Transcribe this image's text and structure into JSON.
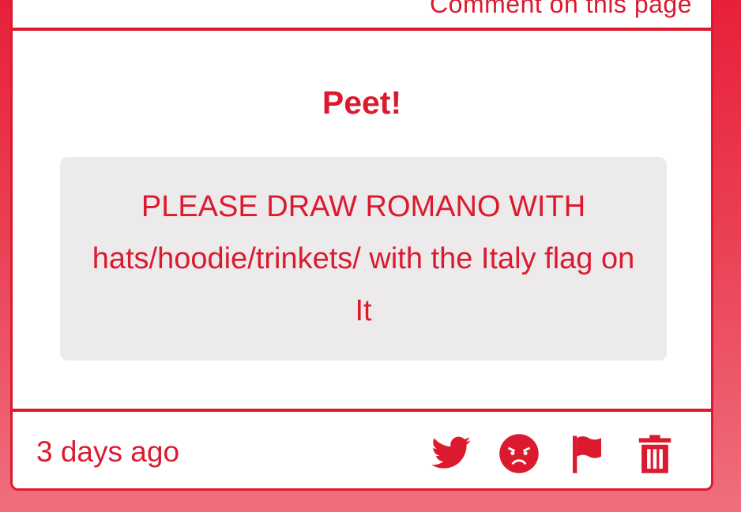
{
  "header": {
    "partial_text": "Comment on this page"
  },
  "post": {
    "title": "Peet!",
    "message": "PLEASE DRAW ROMANO WITH hats/hoodie/trinkets/ with the Italy flag on It",
    "timestamp": "3 days ago"
  },
  "actions": [
    {
      "name": "twitter-icon"
    },
    {
      "name": "angry-face-icon"
    },
    {
      "name": "flag-icon"
    },
    {
      "name": "trash-icon"
    }
  ],
  "colors": {
    "accent": "#dc1a2f",
    "message_bg": "#eceaeb",
    "card_bg": "#ffffff"
  }
}
